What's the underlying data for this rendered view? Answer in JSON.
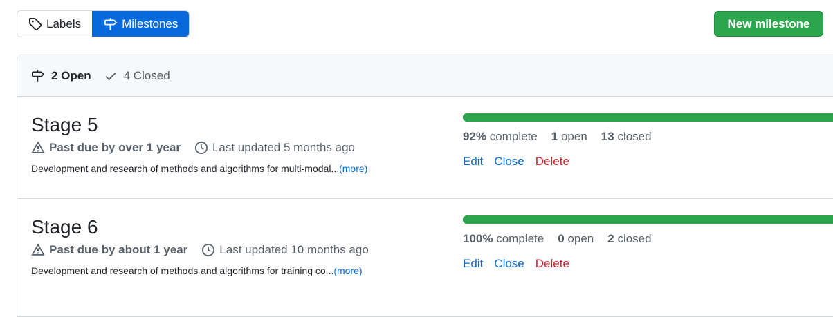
{
  "subnav": {
    "labels": "Labels",
    "milestones": "Milestones"
  },
  "new_milestone_button": "New milestone",
  "states": {
    "open": "2 Open",
    "closed": "4 Closed"
  },
  "milestones": [
    {
      "title": "Stage 5",
      "due": "Past due by over 1 year",
      "updated": "Last updated 5 months ago",
      "description": "Development and research of methods and algorithms for multi-modal...",
      "more": "(more)",
      "percent": 92,
      "percent_label": "92%",
      "complete_word": "complete",
      "open_count": "1",
      "open_word": "open",
      "closed_count": "13",
      "closed_word": "closed"
    },
    {
      "title": "Stage 6",
      "due": "Past due by about 1 year",
      "updated": "Last updated 10 months ago",
      "description": "Development and research of methods and algorithms for training co...",
      "more": "(more)",
      "percent": 100,
      "percent_label": "100%",
      "complete_word": "complete",
      "open_count": "0",
      "open_word": "open",
      "closed_count": "2",
      "closed_word": "closed"
    }
  ],
  "actions": {
    "edit": "Edit",
    "close": "Close",
    "delete": "Delete"
  },
  "icons": {
    "labels": "tag-icon",
    "milestones": "milestone-icon",
    "closed": "check-icon",
    "due": "alert-icon",
    "updated": "clock-icon"
  },
  "colors": {
    "primary_button": "#2da44e",
    "selected_tab": "#0969da",
    "progress": "#2da44e",
    "link": "#0969da",
    "danger": "#cf222e"
  }
}
